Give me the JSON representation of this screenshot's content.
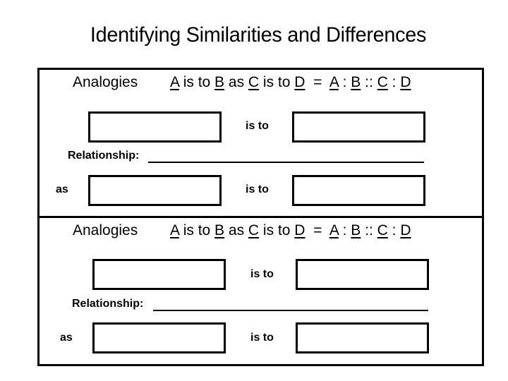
{
  "title": "Identifying Similarities and Differences",
  "sections": [
    {
      "heading": "Analogies",
      "formula": {
        "a": "A",
        "is_to_1": " is to ",
        "b": "B",
        "as": " as ",
        "c": "C",
        "is_to_2": " is to ",
        "d": "D",
        "equals": "  =  ",
        "a2": "A",
        "sep1": " : ",
        "b2": "B",
        "sep2": " :: ",
        "c2": "C",
        "sep3": " : ",
        "d2": "D"
      },
      "is_to_label_1": "is to",
      "relationship_label": "Relationship:",
      "as_label": "as",
      "is_to_label_2": "is to"
    },
    {
      "heading": "Analogies",
      "formula": {
        "a": "A",
        "is_to_1": " is to ",
        "b": "B",
        "as": " as ",
        "c": "C",
        "is_to_2": " is to ",
        "d": "D",
        "equals": "  =  ",
        "a2": "A",
        "sep1": " : ",
        "b2": "B",
        "sep2": " :: ",
        "c2": "C",
        "sep3": " : ",
        "d2": "D"
      },
      "is_to_label_1": "is to",
      "relationship_label": "Relationship:",
      "as_label": "as",
      "is_to_label_2": "is to"
    }
  ]
}
